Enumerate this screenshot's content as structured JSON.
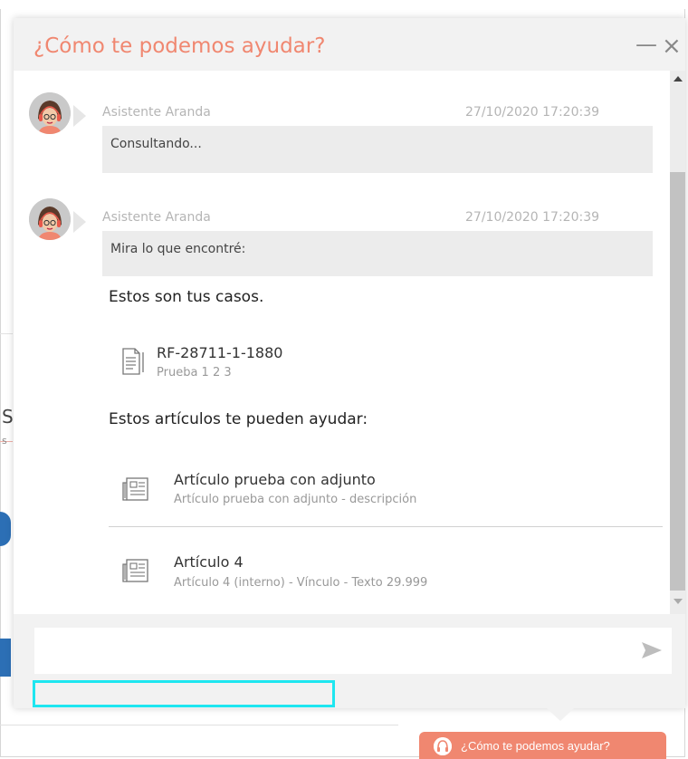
{
  "chat": {
    "title": "¿Cómo te podemos ayudar?",
    "minimize_glyph": "—",
    "close_glyph": "×",
    "messages": [
      {
        "author": "Asistente Aranda",
        "time": "27/10/2020 17:20:39",
        "text": "Consultando..."
      },
      {
        "author": "Asistente Aranda",
        "time": "27/10/2020 17:20:39",
        "text": "Mira lo que encontré:"
      }
    ],
    "cases_heading": "Estos son tus casos.",
    "cases": [
      {
        "title": "RF-28711-1-1880",
        "subtitle": "Prueba 1 2 3",
        "icon": "document-icon"
      }
    ],
    "articles_heading": "Estos artículos te pueden ayudar:",
    "articles": [
      {
        "title": "Artículo prueba con adjunto",
        "subtitle": "Artículo prueba con adjunto - descripción",
        "icon": "newspaper-icon"
      },
      {
        "title": "Artículo 4",
        "subtitle": "Artículo 4 (interno) - Vínculo - Texto 29.999",
        "icon": "newspaper-icon"
      }
    ],
    "input": {
      "value": "",
      "placeholder": ""
    }
  },
  "launcher": {
    "label": "¿Cómo te podemos ayudar?"
  },
  "background": {
    "letter_big": "S",
    "letter_small": "s"
  },
  "colors": {
    "accent": "#f08770",
    "focus": "#1ee6f0",
    "brand_blue": "#2c6fb5"
  }
}
